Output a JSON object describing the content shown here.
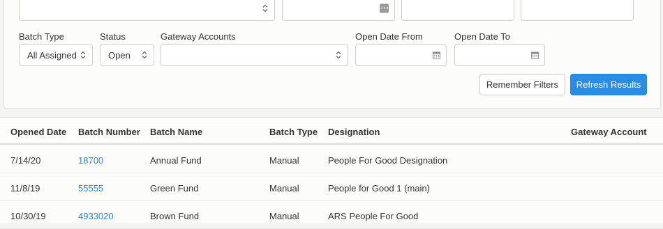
{
  "filters": {
    "batch_type": {
      "label": "Batch Type",
      "value": "All Assigned"
    },
    "status": {
      "label": "Status",
      "value": "Open"
    },
    "gateway_accounts": {
      "label": "Gateway Accounts",
      "value": ""
    },
    "open_date_from": {
      "label": "Open Date From",
      "value": ""
    },
    "open_date_to": {
      "label": "Open Date To",
      "value": ""
    }
  },
  "buttons": {
    "remember_filters": "Remember Filters",
    "refresh_results": "Refresh Results"
  },
  "table": {
    "columns": [
      "Opened Date",
      "Batch Number",
      "Batch Name",
      "Batch Type",
      "Designation",
      "Gateway Account"
    ],
    "rows": [
      {
        "opened_date": "7/14/20",
        "batch_number": "18700",
        "batch_name": "Annual Fund",
        "batch_type": "Manual",
        "designation": "People For Good Designation",
        "gateway_account": ""
      },
      {
        "opened_date": "11/8/19",
        "batch_number": "55555",
        "batch_name": "Green Fund",
        "batch_type": "Manual",
        "designation": "People for Good 1 (main)",
        "gateway_account": ""
      },
      {
        "opened_date": "10/30/19",
        "batch_number": "4933020",
        "batch_name": "Brown Fund",
        "batch_type": "Manual",
        "designation": "ARS People For Good",
        "gateway_account": ""
      }
    ]
  },
  "colors": {
    "primary": "#2b8ce6",
    "link": "#2f86c8"
  },
  "icons": [
    "select-caret-icon",
    "calendar-icon",
    "ellipsis-icon"
  ]
}
